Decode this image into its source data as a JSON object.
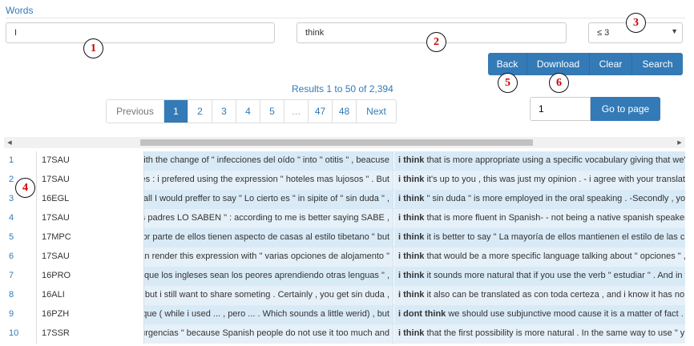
{
  "section": {
    "label": "Words"
  },
  "inputs": {
    "word1": "I",
    "word2": "think",
    "distance": "≤ 3"
  },
  "buttons": {
    "back": "Back",
    "download": "Download",
    "clear": "Clear",
    "search": "Search",
    "goto": "Go to page"
  },
  "results_text": "Results 1 to 50 of 2,394",
  "pagination": {
    "previous": "Previous",
    "pages": [
      "1",
      "2",
      "3",
      "4",
      "5",
      "…",
      "47",
      "48"
    ],
    "next": "Next",
    "goto_value": "1"
  },
  "markers": [
    "1",
    "2",
    "3",
    "4",
    "5",
    "6"
  ],
  "rows": [
    {
      "idx": "1",
      "code": "17SAU",
      "left": "with the change of \" infecciones del oído \" into \" otitis \" , beacuse",
      "kw1": "i",
      "kw2": "think",
      "right": "that is more appropriate using a specific vocabulary giving that we're"
    },
    {
      "idx": "2",
      "code": "17SAU",
      "left": "les : i prefered using the expression \" hoteles mas lujosos \" . But",
      "kw1": "i",
      "kw2": "think",
      "right": "it's up to you , this was just my opinion . - i agree with your translatio"
    },
    {
      "idx": "3",
      "code": "16EGL",
      "left": "f all I would preffer to say \" Lo cierto es \" in sipite of \" sin duda \" ,",
      "kw1": "i",
      "kw2": "think",
      "right": "\" sin duda \" is more employed in the oral speaking . -Secondly , you"
    },
    {
      "idx": "4",
      "code": "17SAU",
      "left": "os padres LO SABEN \" : according to me is better saying SABE ,",
      "kw1": "i",
      "kw2": "think",
      "right": "that is more fluent in Spanish- - not being a native spanish speaker ,"
    },
    {
      "idx": "5",
      "code": "17MPC",
      "left": "yor parte de ellos tienen aspecto de casas al estilo tibetano \" but",
      "kw1": "i",
      "kw2": "think",
      "right": "it is better to say \" La mayoría de ellos mantienen el estilo de las cas"
    },
    {
      "idx": "6",
      "code": "17SAU",
      "left": "an render this expression with \" varias opciones de alojamento \"",
      "kw1": "i",
      "kw2": "think",
      "right": "that would be a more specific language talking about \" opciones \" ,"
    },
    {
      "idx": "7",
      "code": "16PRO",
      "left": "que los ingleses sean los peores aprendiendo otras lenguas \" ,",
      "kw1": "i",
      "kw2": "think",
      "right": "it sounds more natural that if you use the verb \" estudiar \" . And in th"
    },
    {
      "idx": "8",
      "code": "16ALI",
      "left": ", but i still want to share someting . Certainly , you get sin duda ,",
      "kw1": "i",
      "kw2": "think",
      "right": "it also can be translated as con toda certeza , and i know it has no i"
    },
    {
      "idx": "9",
      "code": "16PZH",
      "left": "inque ( while i used ... , pero ... . Which sounds a little werid) , but",
      "kw1": "i",
      "kw2": "dont think",
      "right": "we should use subjunctive mood cause it is a matter of fact . Th"
    },
    {
      "idx": "10",
      "code": "17SSR",
      "left": "urgencias \" because Spanish people do not use it too much and",
      "kw1": "i",
      "kw2": "think",
      "right": "that the first possibility is more natural . In the same way to use \" y p"
    }
  ]
}
